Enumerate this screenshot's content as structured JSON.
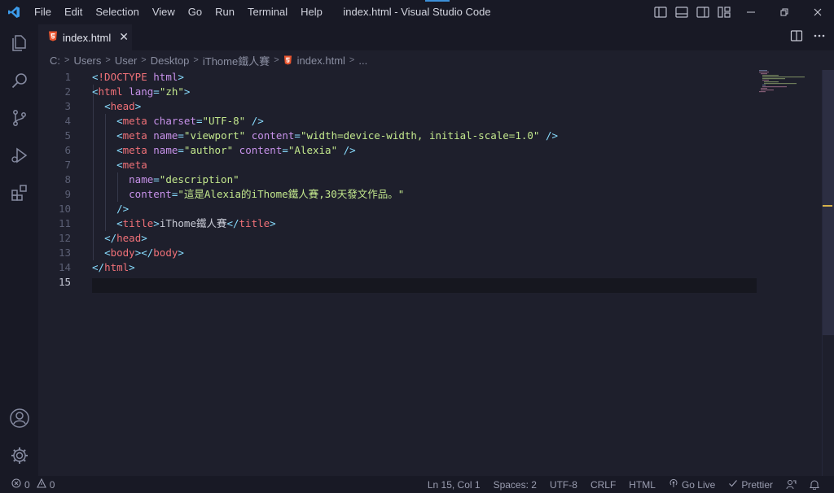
{
  "window": {
    "title": "index.html - Visual Studio Code"
  },
  "menu": [
    "File",
    "Edit",
    "Selection",
    "View",
    "Go",
    "Run",
    "Terminal",
    "Help"
  ],
  "tab": {
    "label": "index.html",
    "close": "✕"
  },
  "breadcrumb": [
    "C:",
    "Users",
    "User",
    "Desktop",
    "iThome鐵人賽",
    "index.html",
    "..."
  ],
  "editor": {
    "line_numbers": [
      "1",
      "2",
      "3",
      "4",
      "5",
      "6",
      "7",
      "8",
      "9",
      "10",
      "11",
      "12",
      "13",
      "14",
      "15"
    ],
    "current_line": 15
  },
  "status": {
    "errors": "0",
    "warnings": "0",
    "position": "Ln 15, Col 1",
    "spaces": "Spaces: 2",
    "encoding": "UTF-8",
    "eol": "CRLF",
    "language": "HTML",
    "golive": "Go Live",
    "prettier": "Prettier"
  },
  "colors": {
    "accent": "#3c8fd8",
    "html_icon": "#e8552f",
    "tag": "#f07178",
    "string": "#c3e88d",
    "attribute": "#c792ea"
  }
}
